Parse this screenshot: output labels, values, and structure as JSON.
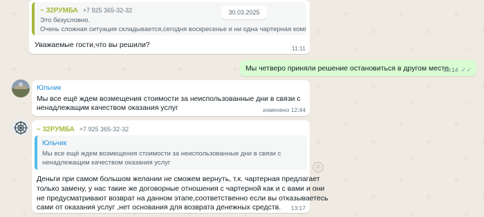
{
  "date_chip": "30.03.2025",
  "messages": [
    {
      "quote": {
        "sender": "~ 32РУМБА",
        "phone": "+7 925 365-32-32",
        "line1": "Это безусловно.",
        "line2": "Очень сложная ситуация складывается,сегодня воскресенье и ни одна чартерная компания..."
      },
      "text": "Уважаемые гости,что вы решили?",
      "time": "11:11"
    },
    {
      "text": "Мы четверо приняли решение остановиться в другом месте.",
      "time": "12:14",
      "status": "✓✓"
    },
    {
      "sender": "Юльчик",
      "line1": "Мы все ещё ждем возмещения стоимости за неиспользованные дни в связи с",
      "line2": "ненадлежащим качеством оказания услуг",
      "time": "изменено 12:44"
    },
    {
      "sender": "~ 32РУМБА",
      "phone": "+7 925 365-32-32",
      "quote": {
        "sender": "Юльчик",
        "line1": "Мы все ещё ждем возмещения стоимости за неиспользованные дни в связи с",
        "line2": "ненадлежащим качеством оказания услуг"
      },
      "line1": "Деньги при самом большом желании не сможем вернуть, т.к. чартерная предлагает",
      "line2": "только замену, у нас такие же договорные отношения с чартерной как и с вами и они",
      "line3": "не предусматривают возврат на данном этапе,соответственно если вы отказываетесь",
      "line4": "сами от оказания услуг ,нет основания для возврата денежных средств.",
      "time": "13:17"
    }
  ]
}
